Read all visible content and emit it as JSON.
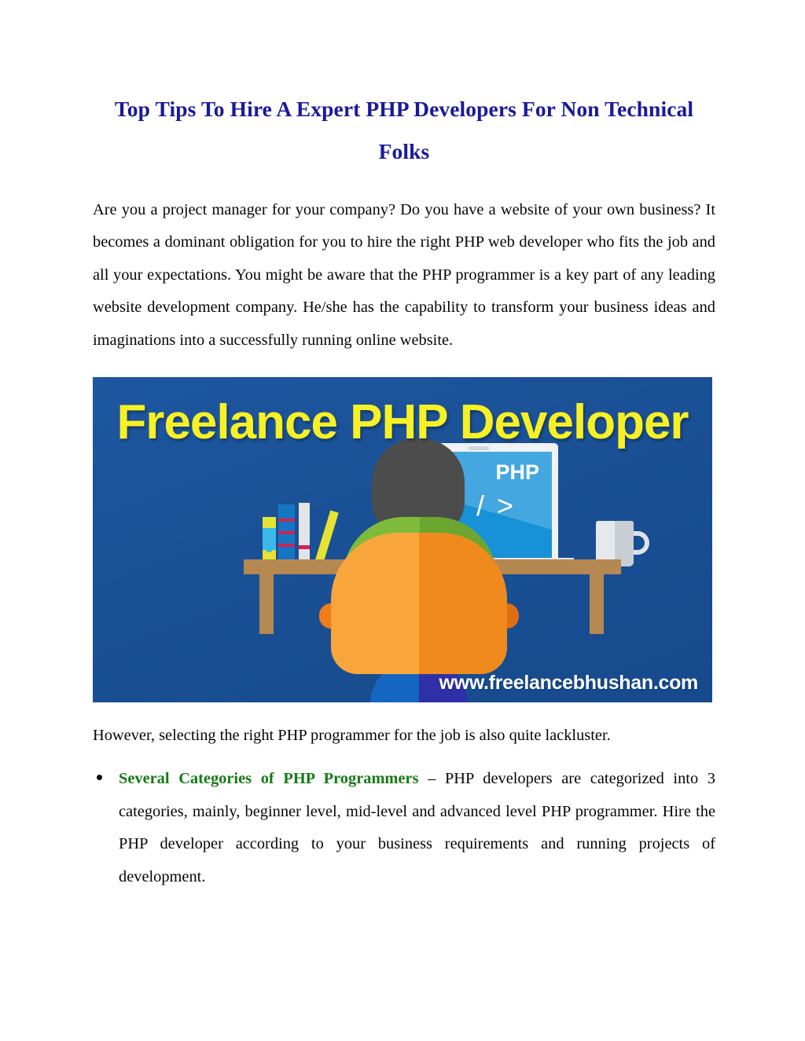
{
  "document": {
    "title": "Top Tips To Hire A Expert PHP Developers For Non Technical Folks",
    "intro_paragraph": "Are you a project manager for your company? Do you have a website of your own business?  It becomes a dominant obligation for you to hire the right PHP web developer who fits the job and all your expectations. You might be aware that the PHP programmer is a key part of any leading website development company. He/she has the capability to transform your business ideas and imaginations into a successfully running online website.",
    "after_image_paragraph": "However, selecting the right PHP programmer for the job is also quite lackluster.",
    "bullets": [
      {
        "lead": "Several Categories of PHP Programmers",
        "rest": " – PHP developers are categorized into 3 categories, mainly, beginner level, mid-level and advanced level PHP programmer. Hire the PHP developer according to your business requirements and running projects of development."
      }
    ]
  },
  "figure": {
    "headline": "Freelance PHP Developer",
    "url": "www.freelancebhushan.com",
    "laptop_label": "PHP",
    "laptop_code": "< / >"
  },
  "colors": {
    "title": "#19199C",
    "body_text": "#060606",
    "bullet_lead": "#157A16",
    "banner_background": "#1B5299",
    "banner_headline": "#F7F025",
    "banner_url": "#FFFFFF",
    "desk": "#B58751",
    "person_shirt": "#7FBB3A",
    "person_body": "#F8A63C",
    "laptop_screen": "#1791D8"
  }
}
